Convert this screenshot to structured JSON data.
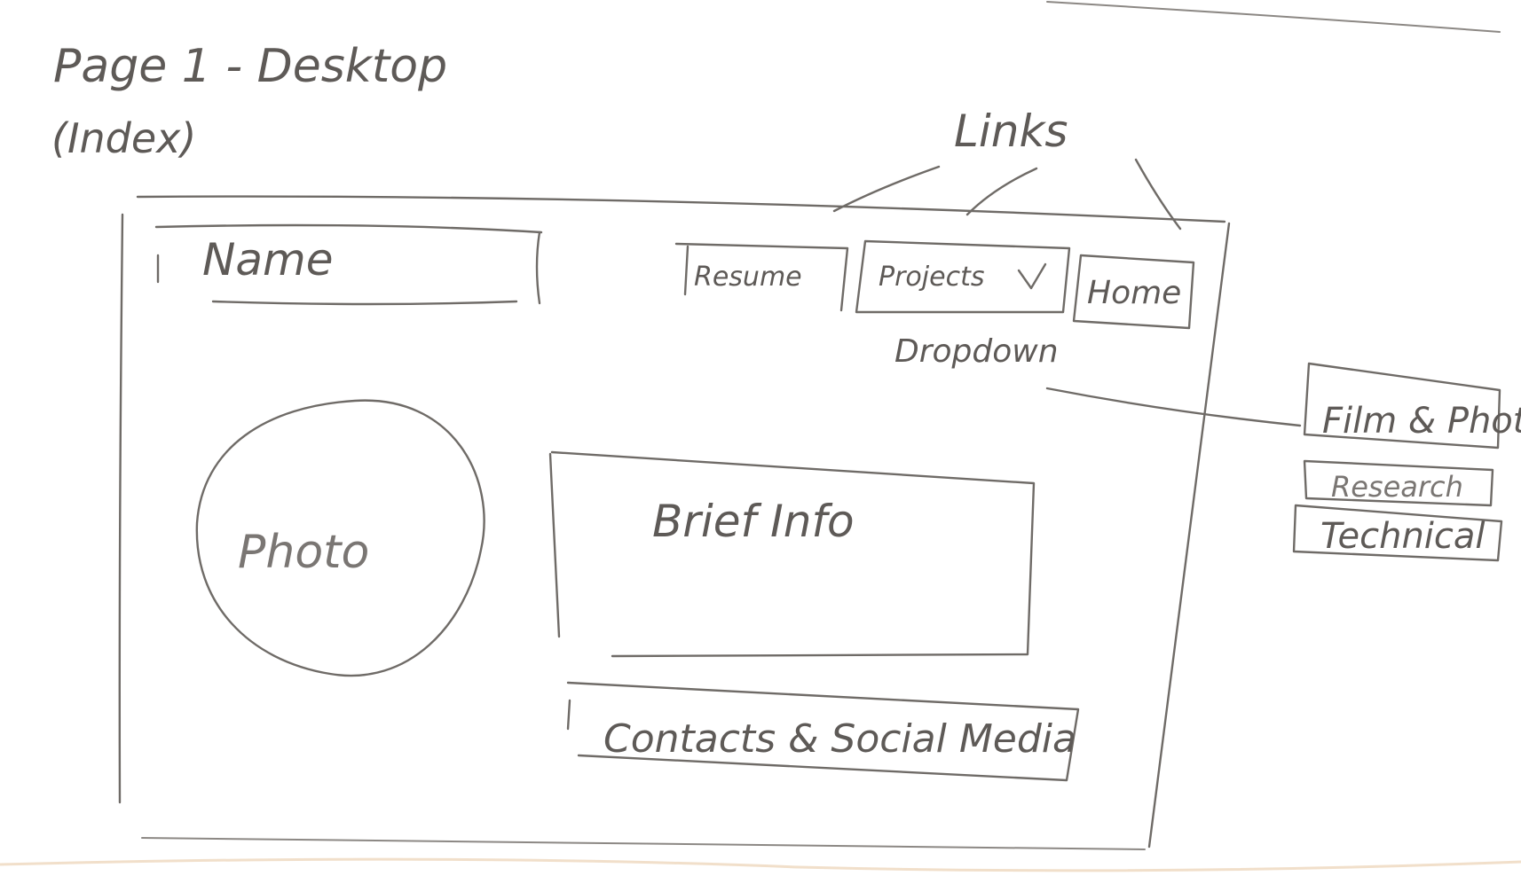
{
  "page_title": {
    "line1": "Page 1 - Desktop",
    "line2": "(Index)"
  },
  "annotations": {
    "links": "Links",
    "dropdown": "Dropdown"
  },
  "header": {
    "name_box": "Name"
  },
  "nav": {
    "resume": "Resume",
    "projects": "Projects",
    "projects_chevron": "chevron-down-icon",
    "home": "Home"
  },
  "dropdown_items": [
    "Film & Photo",
    "Research",
    "Technical"
  ],
  "content": {
    "photo": "Photo",
    "brief_info": "Brief Info",
    "contacts": "Contacts & Social Media"
  }
}
